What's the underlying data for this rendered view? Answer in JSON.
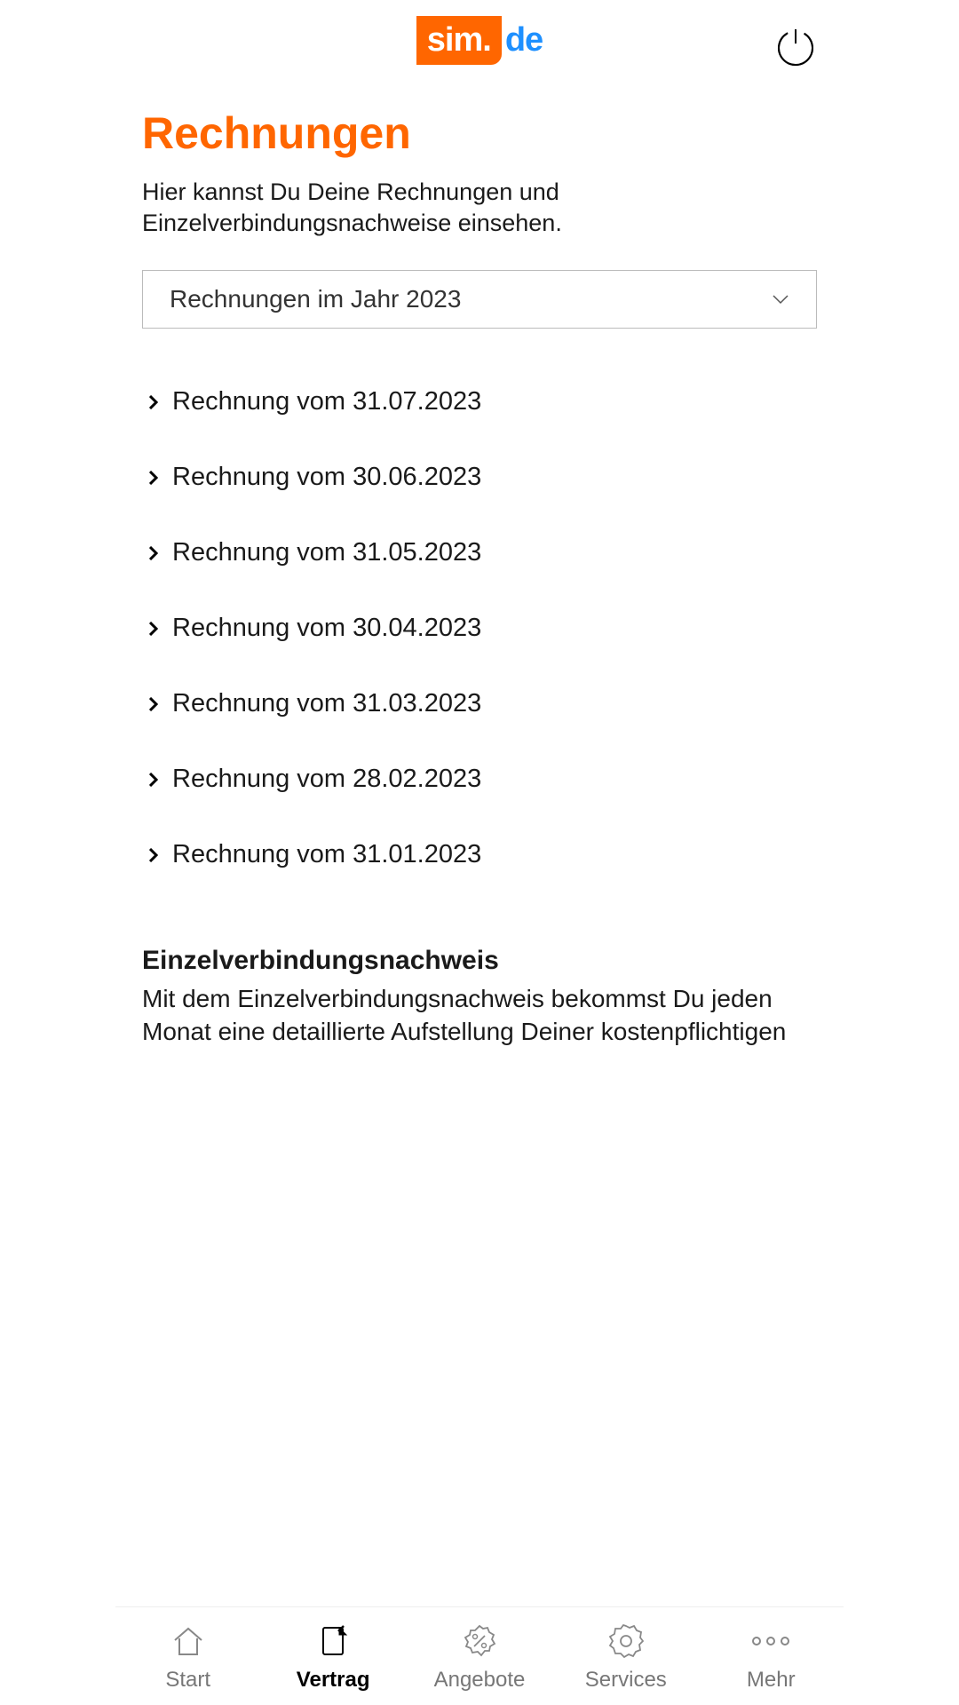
{
  "header": {
    "logo_sim": "sim.",
    "logo_de": "de"
  },
  "page": {
    "title": "Rechnungen",
    "subtitle": "Hier kannst Du Deine Rechnungen und Einzelverbindungsnachweise einsehen."
  },
  "dropdown": {
    "selected": "Rechnungen im Jahr 2023"
  },
  "invoices": [
    "Rechnung vom 31.07.2023",
    "Rechnung vom 30.06.2023",
    "Rechnung vom 31.05.2023",
    "Rechnung vom 30.04.2023",
    "Rechnung vom 31.03.2023",
    "Rechnung vom 28.02.2023",
    "Rechnung vom 31.01.2023"
  ],
  "evn": {
    "title": "Einzelverbindungsnachweis",
    "text": "Mit dem Einzelverbindungsnachweis bekommst Du jeden Monat eine detaillierte Aufstellung Deiner kostenpflichtigen"
  },
  "nav": {
    "start": "Start",
    "vertrag": "Vertrag",
    "angebote": "Angebote",
    "services": "Services",
    "mehr": "Mehr"
  }
}
